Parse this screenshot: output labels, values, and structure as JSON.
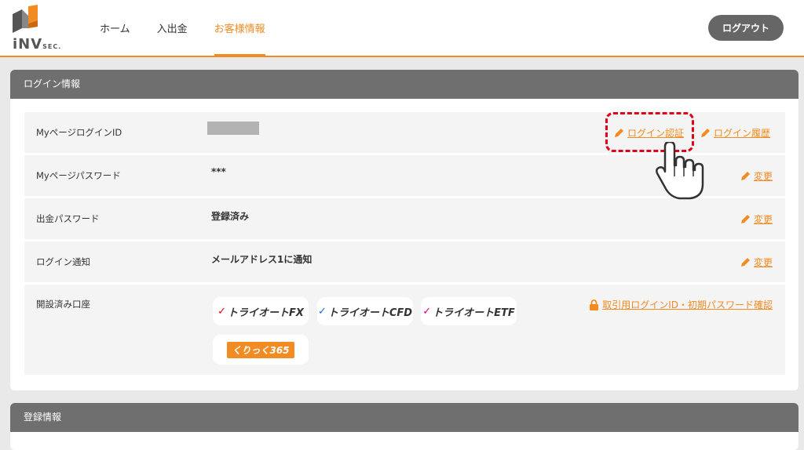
{
  "header": {
    "logo_text": "iNV",
    "logo_sub": "SEC.",
    "nav": [
      {
        "label": "ホーム"
      },
      {
        "label": "入出金"
      },
      {
        "label": "お客様情報",
        "active": true
      }
    ],
    "logout_label": "ログアウト"
  },
  "login_section": {
    "title": "ログイン情報",
    "rows": [
      {
        "label": "MyページログインID",
        "value": "",
        "links": [
          "ログイン認証",
          "ログイン履歴"
        ]
      },
      {
        "label": "Myページパスワード",
        "value": "***",
        "link": "変更"
      },
      {
        "label": "出金パスワード",
        "value": "登録済み",
        "link": "変更"
      },
      {
        "label": "ログイン通知",
        "value": "メールアドレス1に通知",
        "link": "変更"
      },
      {
        "label": "開設済み口座",
        "link": "取引用ログインID・初期パスワード確認",
        "accounts": [
          "トライオートFX",
          "トライオートCFD",
          "トライオートETF",
          "くりっく365"
        ]
      }
    ]
  },
  "register_section": {
    "title": "登録情報"
  },
  "colors": {
    "accent": "#f28b21",
    "header_gray": "#6f6f6f",
    "highlight": "#e00018"
  }
}
